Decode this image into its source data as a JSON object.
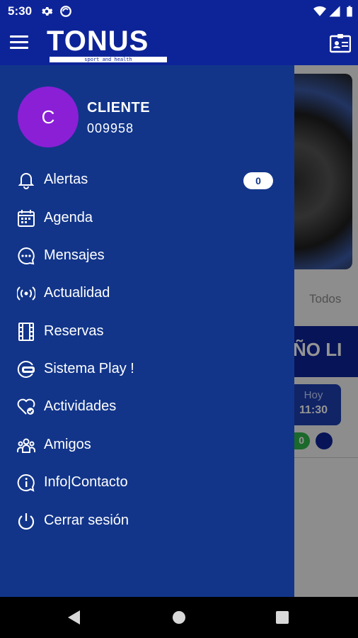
{
  "status_bar": {
    "time": "5:30",
    "icons": [
      "gear-icon",
      "sync-icon",
      "wifi-icon",
      "signal-icon",
      "battery-icon"
    ]
  },
  "app_bar": {
    "brand": "TONUS",
    "tagline": "sport and health",
    "brand_color": "#0d2498"
  },
  "background": {
    "tab_todos": "Todos",
    "banner_text": "ÑO LI",
    "card_day": "Hoy",
    "card_time": "11:30",
    "green_badge": "0"
  },
  "drawer": {
    "user": {
      "avatar_letter": "C",
      "name": "CLIENTE",
      "id": "009958",
      "avatar_color": "#8a1fd6"
    },
    "items": [
      {
        "label": "Alertas",
        "icon": "bell-icon",
        "badge": "0"
      },
      {
        "label": "Agenda",
        "icon": "calendar-icon"
      },
      {
        "label": "Mensajes",
        "icon": "chat-icon"
      },
      {
        "label": "Actualidad",
        "icon": "broadcast-icon"
      },
      {
        "label": "Reservas",
        "icon": "film-icon"
      },
      {
        "label": "Sistema Play !",
        "icon": "play-icon"
      },
      {
        "label": "Actividades",
        "icon": "heart-check-icon"
      },
      {
        "label": "Amigos",
        "icon": "friends-icon"
      },
      {
        "label": "Info|Contacto",
        "icon": "info-icon"
      },
      {
        "label": "Cerrar sesión",
        "icon": "power-icon"
      }
    ]
  }
}
